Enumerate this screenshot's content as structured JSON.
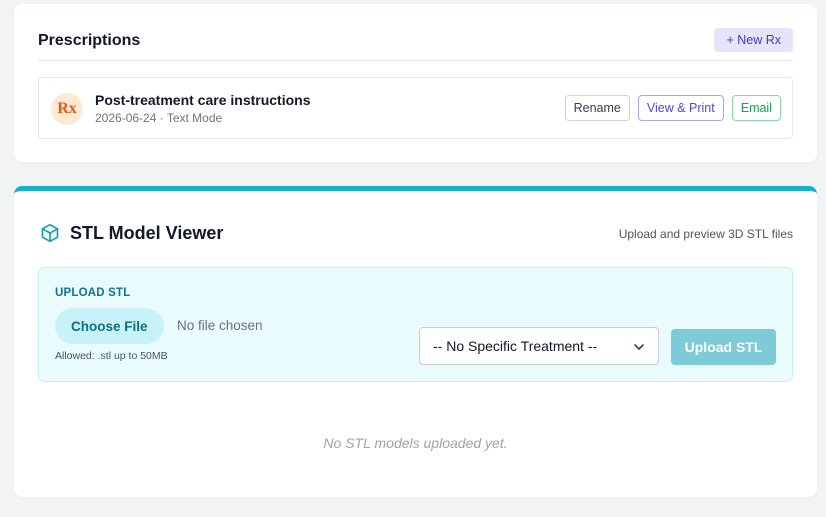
{
  "prescriptions": {
    "title": "Prescriptions",
    "new_button": "+ New Rx",
    "items": [
      {
        "avatar_text": "Rx",
        "name": "Post-treatment care instructions",
        "meta": "2026-06-24 · Text Mode",
        "actions": {
          "rename": "Rename",
          "view_print": "View & Print",
          "email": "Email"
        }
      }
    ]
  },
  "stl_viewer": {
    "icon": "cube-icon",
    "title": "STL Model Viewer",
    "subtitle": "Upload and preview 3D STL files",
    "upload": {
      "label": "UPLOAD STL",
      "choose_button": "Choose File",
      "file_status": "No file chosen",
      "allowed": "Allowed: .stl up to 50MB",
      "treatment_selected": "-- No Specific Treatment --",
      "upload_button": "Upload STL"
    },
    "empty_message": "No STL models uploaded yet."
  },
  "colors": {
    "accent": "#17b0c9",
    "rename": "#374151",
    "view_print": "#4f46e5",
    "email": "#16a34a",
    "upload_disabled": "#7ccbd6"
  }
}
